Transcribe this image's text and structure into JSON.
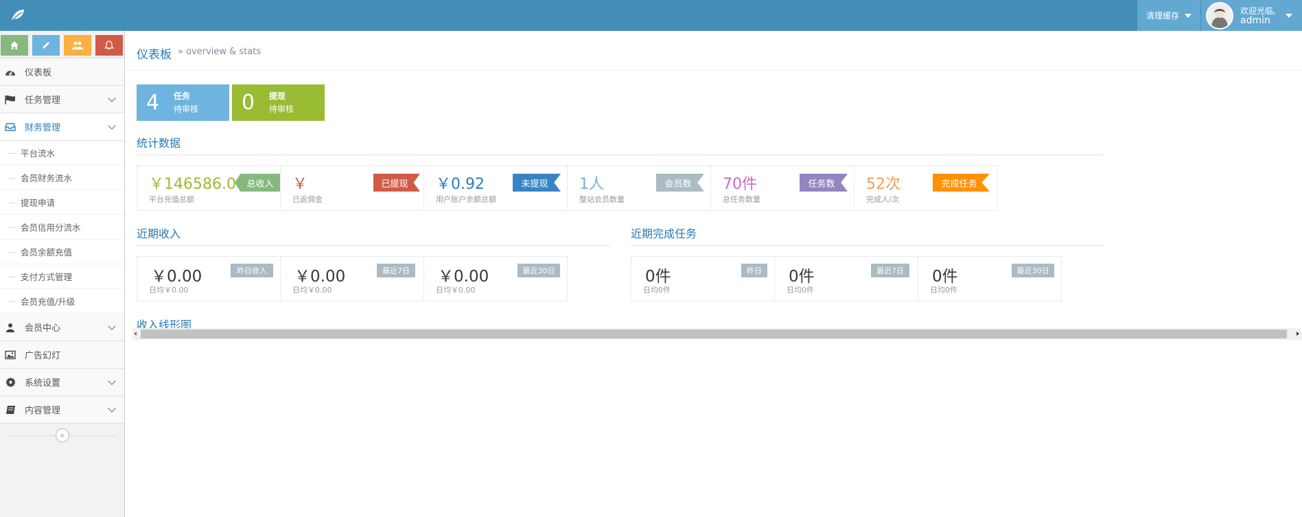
{
  "navbar": {
    "brand_icon": "leaf-icon",
    "clear_cache_label": "清理缓存",
    "welcome": "欢迎光临,",
    "username": "admin"
  },
  "sidebar": {
    "shortcuts": [
      {
        "icon": "home-icon",
        "color": "#87b87f"
      },
      {
        "icon": "pencil-icon",
        "color": "#6fb3e0"
      },
      {
        "icon": "users-icon",
        "color": "#fcb040"
      },
      {
        "icon": "bell-icon",
        "color": "#d15b47"
      }
    ],
    "items": [
      {
        "label": "仪表板",
        "icon": "dashboard-icon"
      },
      {
        "label": "任务管理",
        "icon": "flag-icon"
      },
      {
        "label": "财务管理",
        "icon": "inbox-icon"
      },
      {
        "label": "会员中心",
        "icon": "user-icon"
      },
      {
        "label": "广告幻灯",
        "icon": "picture-icon"
      },
      {
        "label": "系统设置",
        "icon": "gear-icon"
      },
      {
        "label": "内容管理",
        "icon": "book-icon"
      }
    ],
    "finance_sub": [
      {
        "label": "平台流水"
      },
      {
        "label": "会员财务流水"
      },
      {
        "label": "提现申请"
      },
      {
        "label": "会员信用分流水"
      },
      {
        "label": "会员余额充值"
      },
      {
        "label": "支付方式管理"
      },
      {
        "label": "会员充值/升级"
      }
    ],
    "collapse_glyph": "«"
  },
  "header": {
    "title": "仪表板",
    "subtitle": "» overview & stats"
  },
  "infoboxes": [
    {
      "num": "4",
      "line1": "任务",
      "line2": "待审核",
      "color": "#6fb3e0"
    },
    {
      "num": "0",
      "line1": "提现",
      "line2": "待审核",
      "color": "#9abc32"
    }
  ],
  "sections": {
    "stats": "统计数据",
    "recent_income": "近期收入",
    "recent_tasks": "近期完成任务",
    "income_chart": "收入线形图"
  },
  "stats": [
    {
      "value": "￥146586.0",
      "label": "平台充值总额",
      "tag": "总收入",
      "value_color": "#9abc32",
      "tag_color": "#87b87f"
    },
    {
      "value": "￥",
      "label": "已返佣金",
      "tag": "已提现",
      "value_color": "#d15b47",
      "tag_color": "#d15b47"
    },
    {
      "value": "￥0.92",
      "label": "用户账户余额总额",
      "tag": "未提现",
      "value_color": "#2b7dbc",
      "tag_color": "#3983c2"
    },
    {
      "value": "1人",
      "label": "整站会员数量",
      "tag": "会员数",
      "value_color": "#6fb3e0",
      "tag_color": "#abbac3"
    },
    {
      "value": "70件",
      "label": "总任务数量",
      "tag": "任务数",
      "value_color": "#c86cc8",
      "tag_color": "#9585bf"
    },
    {
      "value": "52次",
      "label": "完成人/次",
      "tag": "完成任务",
      "value_color": "#f89c55",
      "tag_color": "#ff9100"
    }
  ],
  "recent_income": [
    {
      "value": "￥0.00",
      "badge": "昨日收入",
      "sub": "日均￥0.00"
    },
    {
      "value": "￥0.00",
      "badge": "最近7日",
      "sub": "日均￥0.00"
    },
    {
      "value": "￥0.00",
      "badge": "最近30日",
      "sub": "日均￥0.00"
    }
  ],
  "recent_tasks": [
    {
      "value": "0件",
      "badge": "昨日",
      "sub": "日均0件"
    },
    {
      "value": "0件",
      "badge": "最近7日",
      "sub": "日均0件"
    },
    {
      "value": "0件",
      "badge": "最近30日",
      "sub": "日均0件"
    }
  ]
}
